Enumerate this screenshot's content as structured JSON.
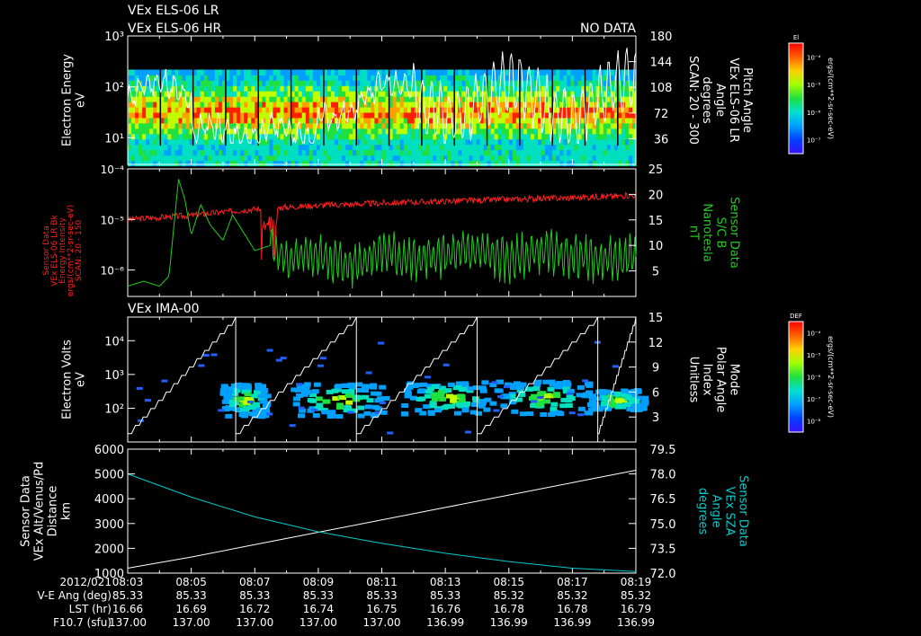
{
  "header": {
    "title_lr": "VEx ELS-06 LR",
    "title_hr": "VEx ELS-06 HR",
    "no_data": "NO DATA"
  },
  "colors": {
    "background": "#000000",
    "axis": "#ffffff",
    "energy_intensity": "#ff2020",
    "magnetic_field": "#22cc22",
    "sza": "#00cccc",
    "altitude": "#ffffff"
  },
  "x_axis": {
    "first_label": "2012/021",
    "ticks": [
      "08:03",
      "08:05",
      "08:07",
      "08:09",
      "08:11",
      "08:13",
      "08:15",
      "08:17",
      "08:19"
    ],
    "rows": [
      {
        "label": "V-E Ang (deg)",
        "values": [
          "85.33",
          "85.33",
          "85.33",
          "85.33",
          "85.33",
          "85.33",
          "85.32",
          "85.32",
          "85.32"
        ]
      },
      {
        "label": "LST (hr)",
        "values": [
          "16.66",
          "16.69",
          "16.72",
          "16.74",
          "16.75",
          "16.76",
          "16.78",
          "16.78",
          "16.79"
        ]
      },
      {
        "label": "F10.7 (sfu)",
        "values": [
          "137.00",
          "137.00",
          "137.00",
          "137.00",
          "137.00",
          "136.99",
          "136.99",
          "136.99",
          "136.99"
        ]
      }
    ]
  },
  "colorbars": {
    "els": {
      "title": "El",
      "units": "ergs/(cm**2-sr-sec-eV)",
      "ticks": [
        "10⁻⁴",
        "10⁻⁵",
        "10⁻⁶",
        "10⁻⁷"
      ]
    },
    "ima": {
      "title": "DEF",
      "units": "ergs/(cm**2-sr-sec-eV)",
      "ticks": [
        "10⁻⁴",
        "10⁻⁵",
        "10⁻⁶",
        "10⁻⁷",
        "10⁻⁸"
      ]
    }
  },
  "chart_data": [
    {
      "type": "heatmap",
      "title": "VEx ELS-06 LR / VEx ELS-06 HR",
      "ylabel": "Electron Energy\neV",
      "yscale": "log",
      "ylim": [
        3,
        1000
      ],
      "ytick_labels": [
        "10¹",
        "10²",
        "10³"
      ],
      "y2label": "Pitch Angle\nVEx ELS-06 LR\nAngle\ndegrees\nSCAN: 20 - 300",
      "y2lim": [
        0,
        180
      ],
      "y2ticks": [
        "36",
        "72",
        "108",
        "144",
        "180"
      ],
      "overlay_line": {
        "axis": "right",
        "color": "#ffffff"
      }
    },
    {
      "type": "line",
      "ylabel": "Sensor Data\nVEx ELS-06 LR Bk\nEnergy Intensity\nergs/(cm**2-sr-sec-eV)\nSCAN: 20 - 150",
      "yscale": "log",
      "ylim": [
        3e-07,
        0.0001
      ],
      "ytick_labels": [
        "10⁻⁴",
        "10⁻⁵",
        "10⁻⁶"
      ],
      "y2label": "Sensor Data\nS/C B\nNanotesla\nnT",
      "y2lim": [
        0,
        25
      ],
      "y2ticks": [
        "5",
        "10",
        "15",
        "20",
        "25"
      ],
      "series": [
        {
          "axis": "left",
          "color": "#ff2020",
          "x": [
            0,
            2,
            4,
            6,
            8,
            10,
            12,
            14,
            16
          ],
          "y": [
            1e-05,
            1.2e-05,
            1.6e-05,
            1.9e-05,
            2.1e-05,
            2.3e-05,
            2.5e-05,
            2.7e-05,
            3e-05
          ]
        },
        {
          "axis": "right",
          "color": "#22cc22",
          "x": [
            0,
            0.5,
            1,
            1.3,
            1.6,
            1.8,
            2.0,
            2.3,
            2.6,
            3.0,
            3.3,
            3.6,
            4.0,
            4.5,
            5,
            6,
            7,
            8,
            9,
            10,
            11,
            12,
            13,
            14,
            15,
            16
          ],
          "y": [
            2.0,
            3.0,
            2.0,
            4.0,
            23.0,
            19.0,
            12.0,
            18.0,
            14.0,
            11.0,
            16.0,
            13.0,
            9.0,
            10.0,
            7.0,
            8.0,
            6.0,
            9.0,
            7.0,
            8.0,
            9.0,
            7.0,
            9.0,
            8.0,
            7.0,
            8.0
          ]
        }
      ]
    },
    {
      "type": "heatmap",
      "title": "VEx IMA-00",
      "ylabel": "Electron Volts\neV",
      "yscale": "log",
      "ylim": [
        10,
        50000
      ],
      "ytick_labels": [
        "10²",
        "10³",
        "10⁴"
      ],
      "y2label": "Mode\nPolar Angle\nIndex\nUnitless",
      "y2lim": [
        0,
        15
      ],
      "y2ticks": [
        "3",
        "6",
        "9",
        "12",
        "15"
      ],
      "overlay_line": {
        "axis": "right",
        "color": "#ffffff",
        "pattern": "sawtooth"
      }
    },
    {
      "type": "line",
      "ylabel": "Sensor Data\nVEx Alt/Venus/Pd\nDistance\nkm",
      "ylim": [
        1000,
        6000
      ],
      "yticks": [
        1000,
        2000,
        3000,
        4000,
        5000,
        6000
      ],
      "y2label": "Sensor Data\nVEx SZA\nAngle\ndegrees",
      "y2lim": [
        72.0,
        79.5
      ],
      "y2ticks": [
        "72.0",
        "73.5",
        "75.0",
        "76.5",
        "78.0",
        "79.5"
      ],
      "x": [
        0,
        2,
        4,
        6,
        8,
        10,
        12,
        14,
        16
      ],
      "series": [
        {
          "axis": "left",
          "color": "#ffffff",
          "y": [
            1200,
            1650,
            2150,
            2650,
            3150,
            3650,
            4150,
            4650,
            5150
          ]
        },
        {
          "axis": "right",
          "color": "#00cccc",
          "y": [
            78.0,
            76.6,
            75.4,
            74.5,
            73.8,
            73.2,
            72.7,
            72.3,
            72.1
          ]
        }
      ]
    }
  ]
}
